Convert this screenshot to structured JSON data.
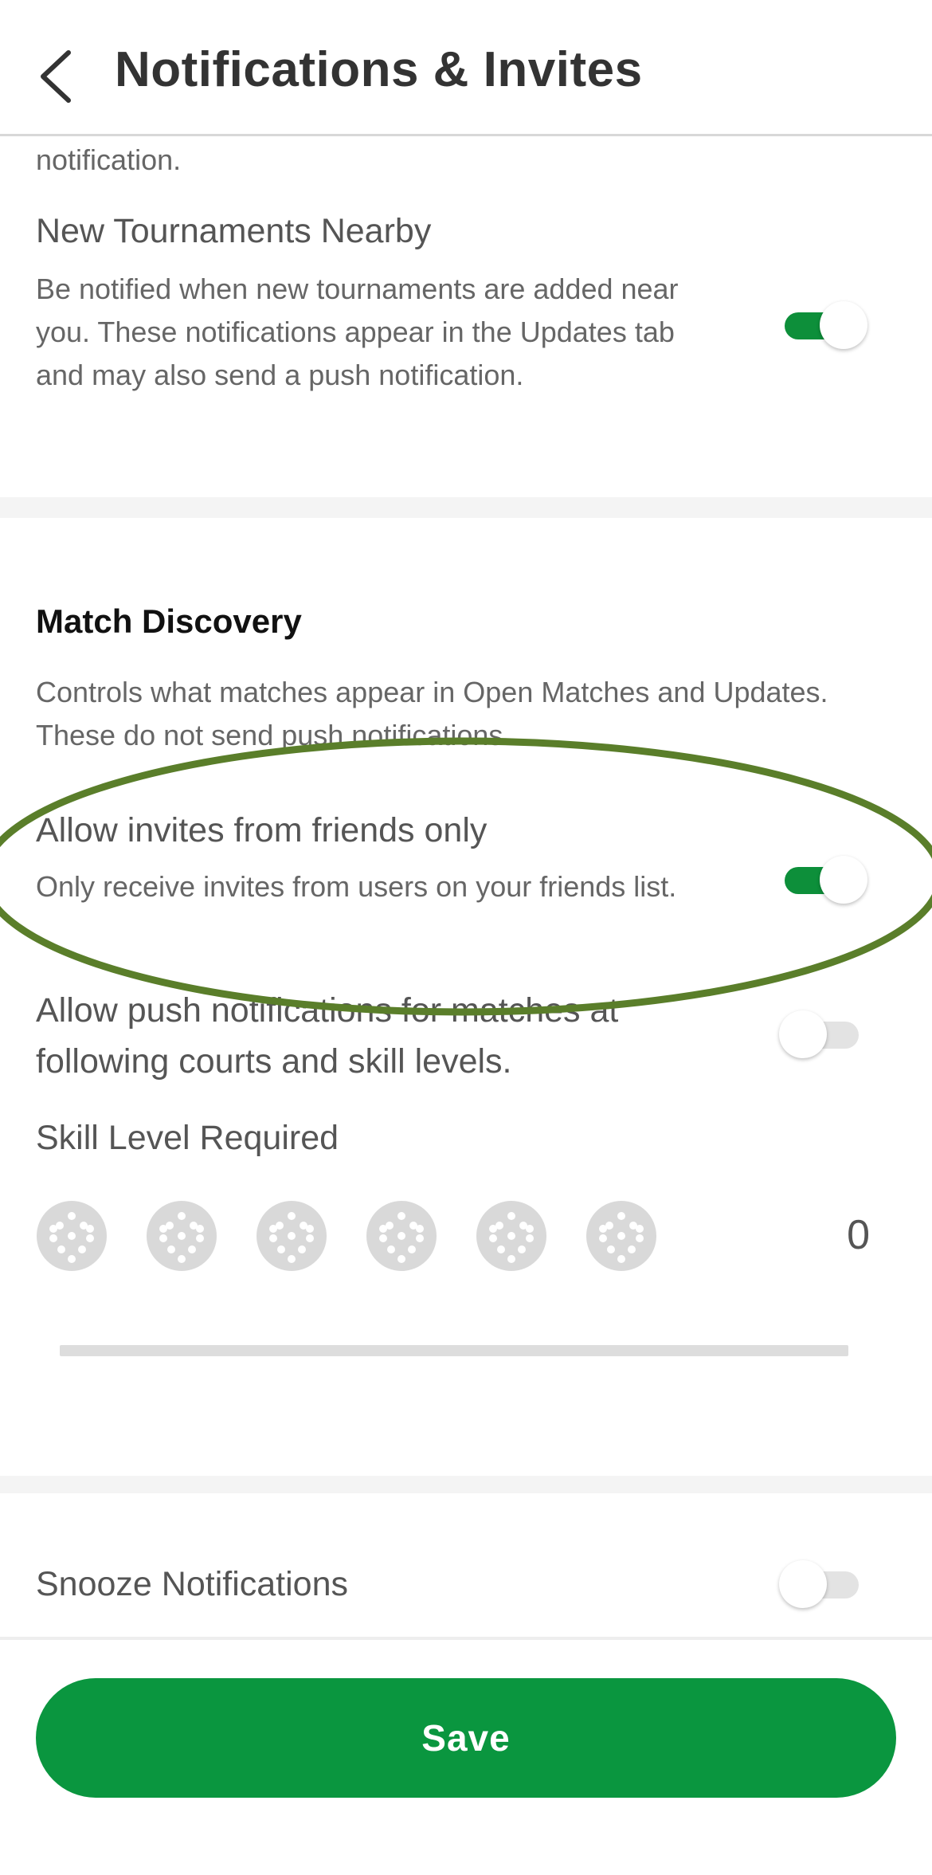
{
  "header": {
    "title": "Notifications & Invites"
  },
  "clipped_text": "notification.",
  "tournaments": {
    "title": "New Tournaments Nearby",
    "desc": "Be notified when new tournaments are added near you. These notifications appear in the Updates tab and may also send a push notification.",
    "enabled": true
  },
  "match_discovery": {
    "title": "Match Discovery",
    "desc": "Controls what matches appear in Open Matches and Updates. These do not send push notifications.",
    "friends_only": {
      "title": "Allow invites from friends only",
      "desc": "Only receive invites from users on your friends list.",
      "enabled": true
    },
    "push_matches": {
      "title": "Allow push notifications for matches at following courts and skill levels.",
      "enabled": false
    },
    "skill": {
      "title": "Skill Level Required",
      "icon": "pickleball-icon",
      "ball_count": 6,
      "value": "0"
    }
  },
  "snooze": {
    "title": "Snooze Notifications",
    "enabled": false
  },
  "save_label": "Save",
  "colors": {
    "accent": "#0a963f",
    "toggle_on": "#0d8f3a",
    "annotation": "#5a7e2a"
  }
}
